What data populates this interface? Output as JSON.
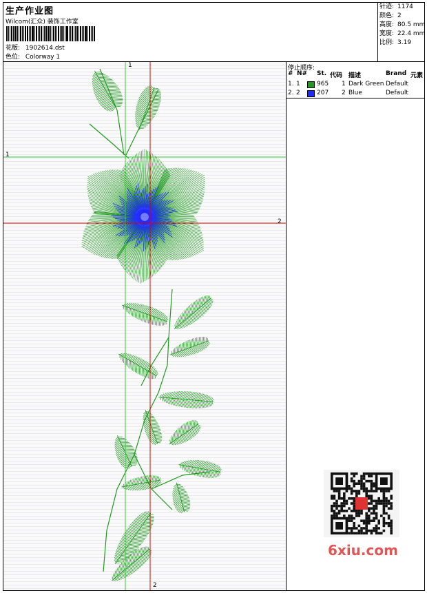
{
  "header": {
    "title": "生产作业图",
    "company": "Wilcom(汇众) 装饰工作室",
    "design_label": "花版:",
    "design_value": "1902614.dst",
    "colorway_label": "色位:",
    "colorway_value": "Colorway 1"
  },
  "stats": [
    {
      "label": "针迹:",
      "value": "1174"
    },
    {
      "label": "颜色:",
      "value": "2"
    },
    {
      "label": "高度:",
      "value": "80.5 mm"
    },
    {
      "label": "宽度:",
      "value": "22.4 mm"
    },
    {
      "label": "比例:",
      "value": "3.19"
    }
  ],
  "stops": {
    "title": "停止顺序:",
    "columns": [
      "#",
      "N#",
      "St.",
      "代码",
      "描述",
      "Brand",
      "元素"
    ],
    "rows": [
      {
        "index": "1.",
        "n": "1",
        "color": "#1e9a1e",
        "stitches": "965",
        "code": "1",
        "description": "Dark Green",
        "brand": "Default"
      },
      {
        "index": "2.",
        "n": "2",
        "color": "#1f2bff",
        "stitches": "207",
        "code": "2",
        "description": "Blue",
        "brand": "Default"
      }
    ]
  },
  "guides": {
    "v1": "1",
    "h1": "1",
    "h2": "2",
    "v2": "2"
  },
  "colors": {
    "green": "#1e9a1e",
    "blue": "#1f2bff",
    "guide_green": "#33cc33",
    "guide_red": "#e00000"
  },
  "watermark": "6xiu.com"
}
